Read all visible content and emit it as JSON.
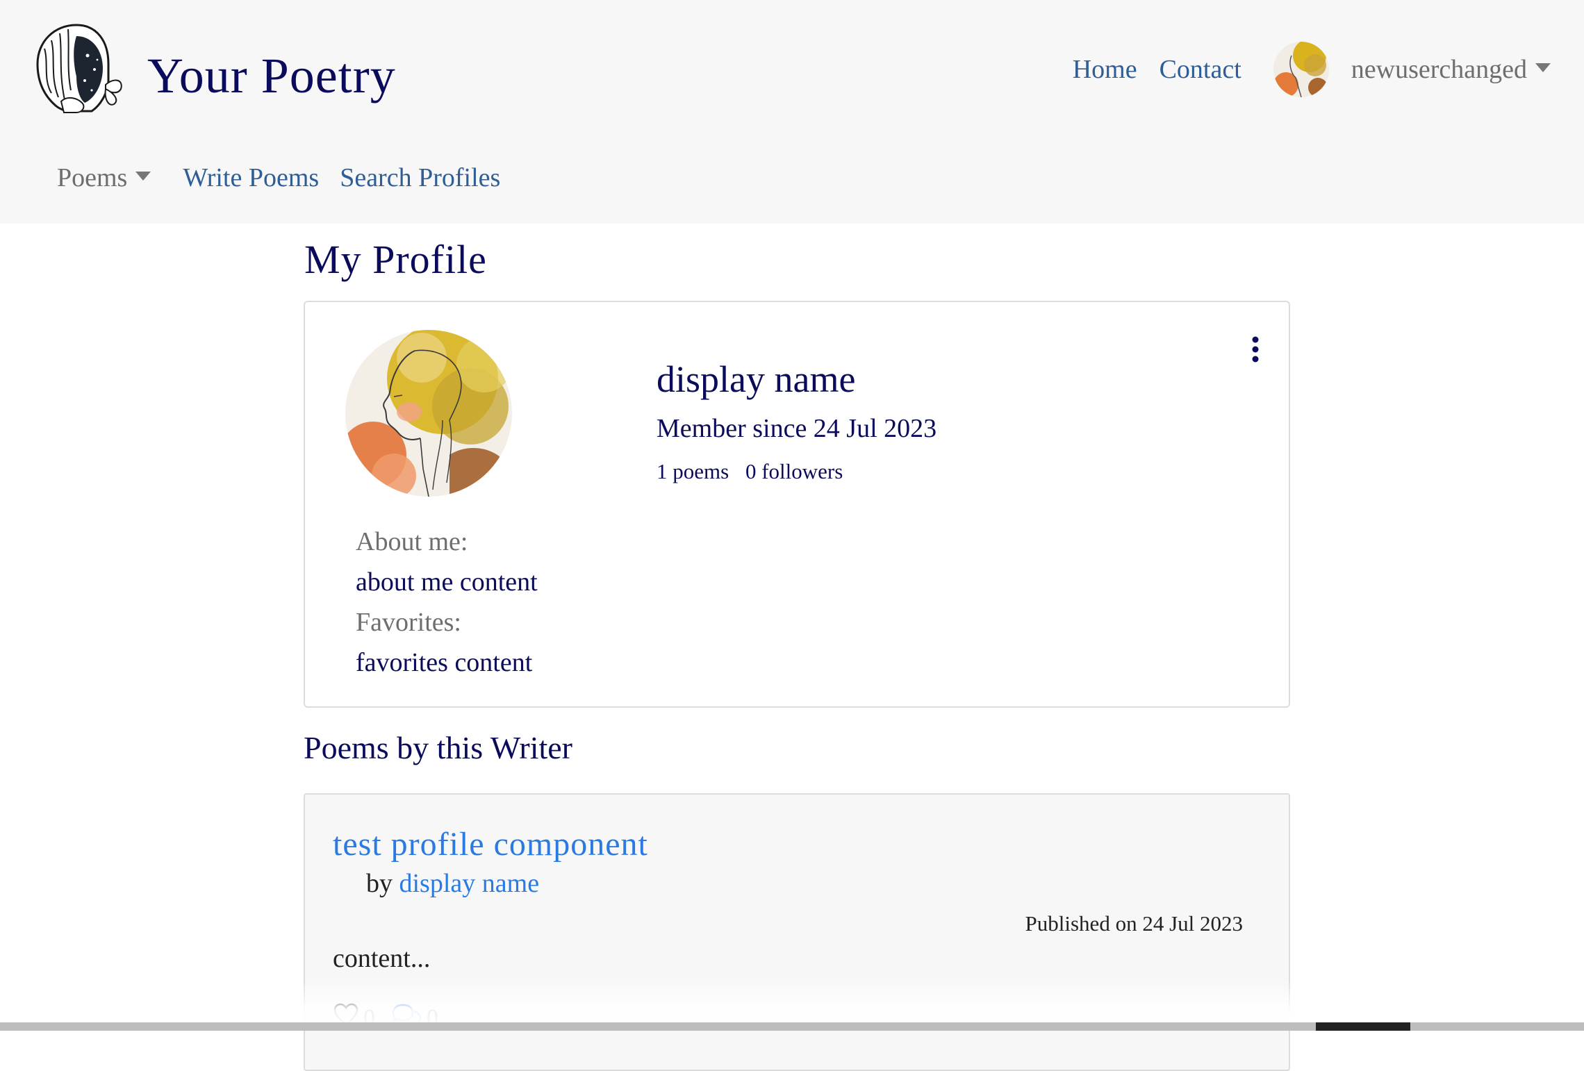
{
  "brand": {
    "title": "Your Poetry",
    "logo_icon": "woman-face-logo"
  },
  "nav": {
    "home": "Home",
    "contact": "Contact",
    "username": "newuserchanged",
    "poems_dropdown": "Poems",
    "write_poems": "Write Poems",
    "search_profiles": "Search Profiles"
  },
  "page": {
    "title": "My Profile"
  },
  "profile": {
    "display_name": "display name",
    "member_since": "Member since 24 Jul 2023",
    "poems_count": "1 poems",
    "followers_count": "0 followers",
    "about_label": "About me:",
    "about_value": "about me content",
    "favorites_label": "Favorites:",
    "favorites_value": "favorites content",
    "options_icon": "kebab-menu-icon"
  },
  "poems_section": {
    "title": "Poems by this Writer",
    "items": [
      {
        "title": "test profile component",
        "by_label": "by",
        "author": "display name",
        "published": "Published on 24 Jul 2023",
        "excerpt": "content...",
        "likes": "0",
        "comments": "0"
      }
    ]
  },
  "colors": {
    "navy": "#0b0b5c",
    "link_blue": "#2f5e97",
    "accent_blue": "#2a7ae2",
    "navbar_bg": "#f7f7f7",
    "muted_gray": "#6e6e6e"
  }
}
